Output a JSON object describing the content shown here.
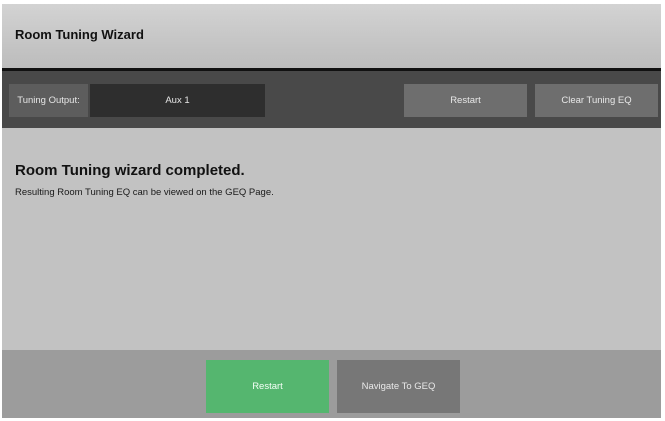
{
  "header": {
    "title": "Room Tuning Wizard"
  },
  "toolbar": {
    "output_label": "Tuning Output:",
    "output_value": "Aux 1",
    "restart_label": "Restart",
    "clear_label": "Clear Tuning EQ"
  },
  "main": {
    "heading": "Room Tuning wizard completed.",
    "message": "Resulting Room Tuning EQ can be viewed on the GEQ Page."
  },
  "footer": {
    "restart_label": "Restart",
    "navigate_label": "Navigate To GEQ"
  },
  "colors": {
    "primary_action": "#55b66f",
    "toolbar_bg": "#494949",
    "content_bg": "#c2c2c2"
  }
}
